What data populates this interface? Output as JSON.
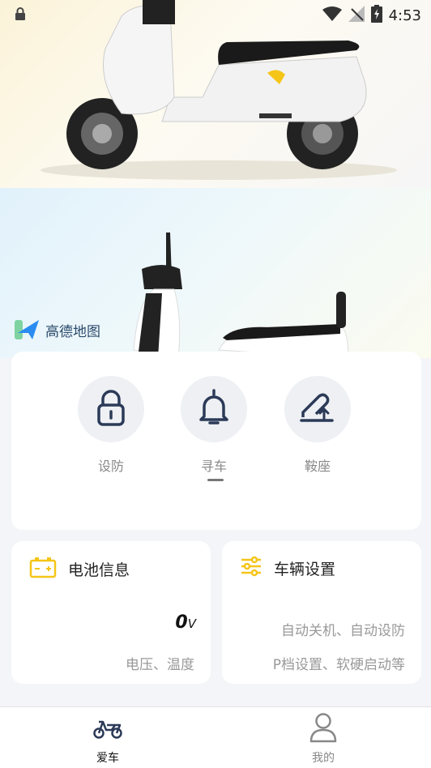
{
  "status_bar": {
    "time": "4:53"
  },
  "map": {
    "logo_text": "高德地图"
  },
  "controls": [
    {
      "label": "设防",
      "icon": "lock-icon"
    },
    {
      "label": "寻车",
      "icon": "bell-icon"
    },
    {
      "label": "鞍座",
      "icon": "seat-icon"
    }
  ],
  "battery_card": {
    "title": "电池信息",
    "voltage": "0",
    "unit": "V",
    "subtitle": "电压、温度"
  },
  "settings_card": {
    "title": "车辆设置",
    "line1": "自动关机、自动设防",
    "line2": "P档设置、软硬启动等"
  },
  "tabs": [
    {
      "label": "爱车",
      "icon": "scooter-icon"
    },
    {
      "label": "我的",
      "icon": "person-icon"
    }
  ],
  "colors": {
    "accent": "#f5c518",
    "icon_dark": "#2b3a57"
  }
}
